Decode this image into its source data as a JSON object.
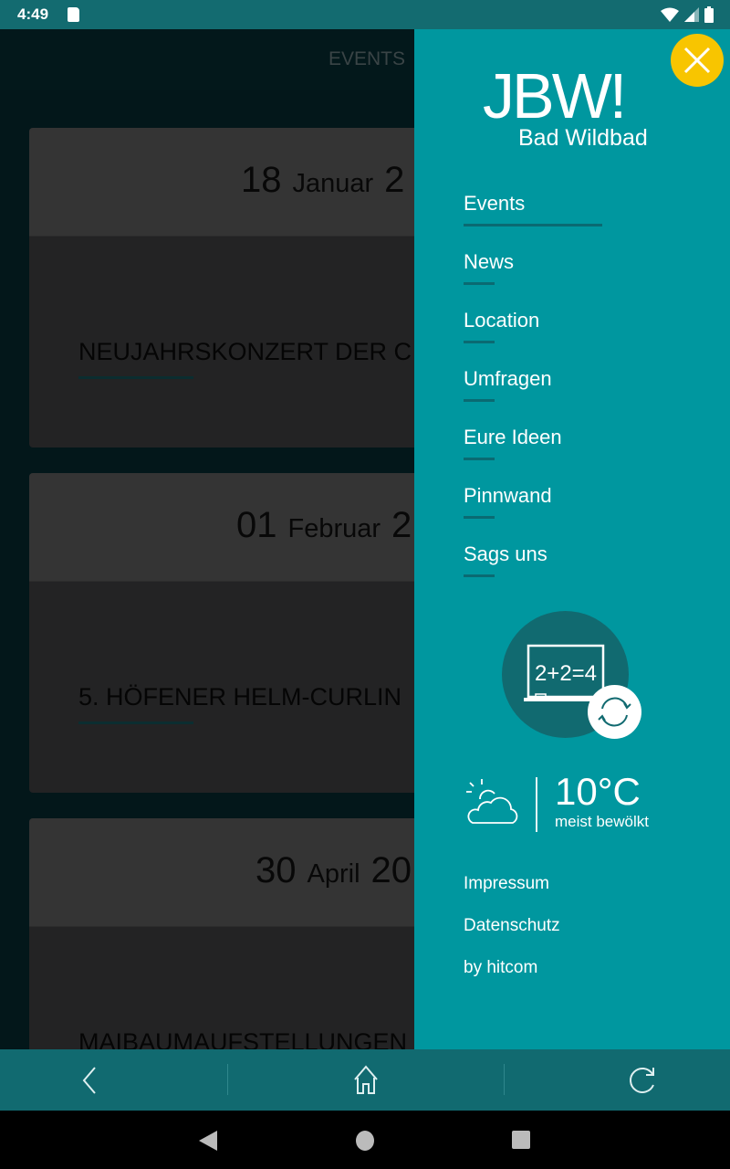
{
  "status_bar": {
    "time": "4:49"
  },
  "app_bar": {
    "title": "EVENTS"
  },
  "events": [
    {
      "day": "18",
      "month": "Januar",
      "year": "2",
      "name": "NEUJAHRSKONZERT DER C"
    },
    {
      "day": "01",
      "month": "Februar",
      "year": "2",
      "name": "5. HÖFENER HELM-CURLIN"
    },
    {
      "day": "30",
      "month": "April",
      "year": "20",
      "name": "MAIBAUMAUFSTELLUNGEN"
    }
  ],
  "drawer": {
    "logo": "JBW!",
    "logo_sub": "Bad Wildbad",
    "nav": [
      {
        "label": "Events",
        "active": true
      },
      {
        "label": "News"
      },
      {
        "label": "Location"
      },
      {
        "label": "Umfragen"
      },
      {
        "label": "Eure Ideen"
      },
      {
        "label": "Pinnwand"
      },
      {
        "label": "Sags uns"
      }
    ],
    "quiz": {
      "board_text": "2+2=4",
      "icon": "chalkboard-refresh-icon"
    },
    "weather": {
      "temperature": "10°C",
      "description": "meist bewölkt",
      "icon": "partly-cloudy-icon"
    },
    "links": [
      "Impressum",
      "Datenschutz",
      "by hitcom"
    ]
  },
  "colors": {
    "drawer": "#00979f",
    "accent": "#f8c500",
    "bar": "#116a70"
  }
}
